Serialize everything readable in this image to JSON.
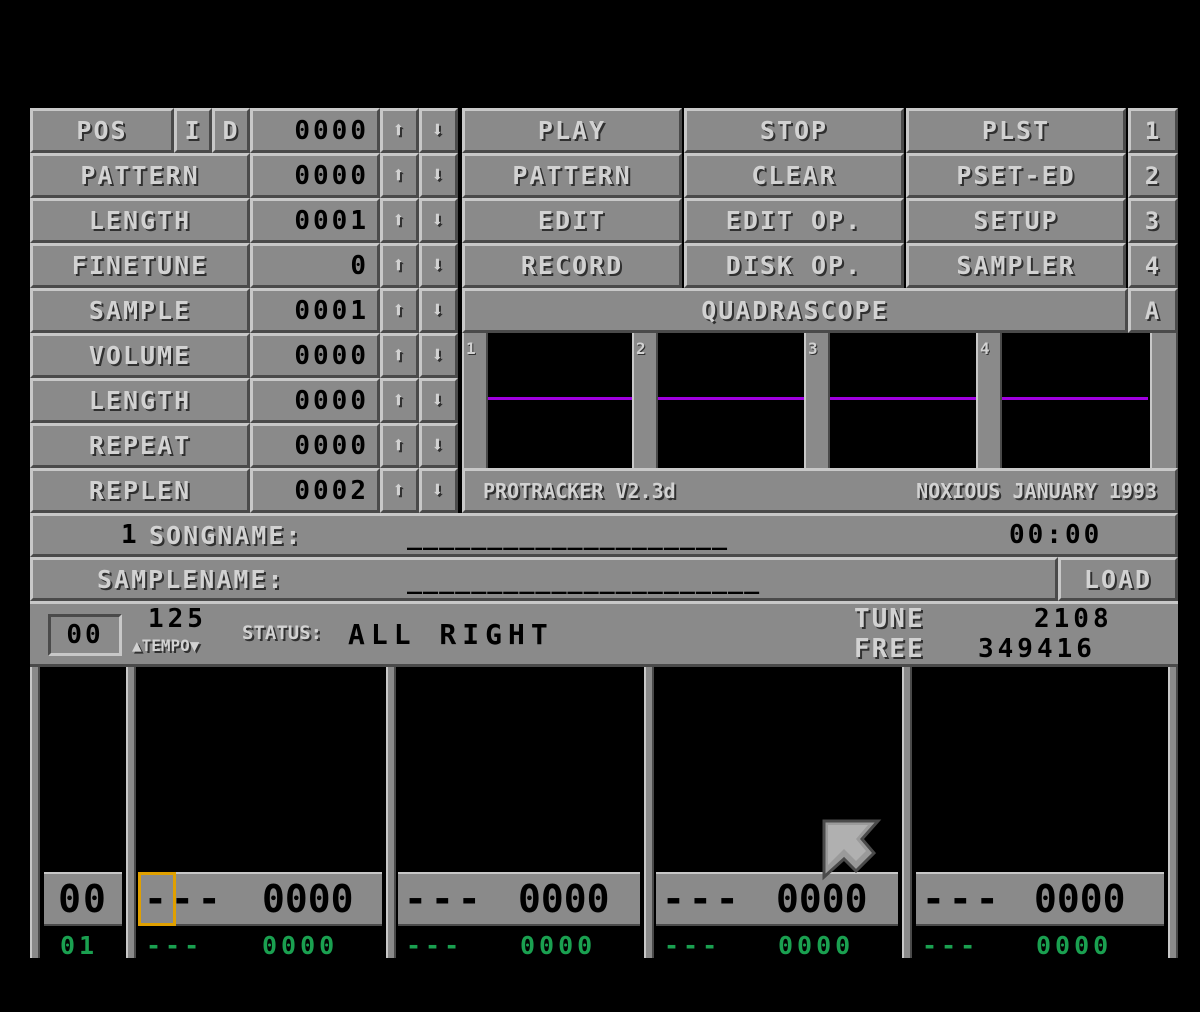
{
  "controls": {
    "pos_label": "POS",
    "i_label": "I",
    "d_label": "D",
    "pos_value": "0000",
    "pattern_label": "PATTERN",
    "pattern_value": "0000",
    "length_label": "LENGTH",
    "length_value": "0001",
    "finetune_label": "FINETUNE",
    "finetune_value": "0",
    "sample_label": "SAMPLE",
    "sample_value": "0001",
    "volume_label": "VOLUME",
    "volume_value": "0000",
    "sample_length_label": "LENGTH",
    "sample_length_value": "0000",
    "repeat_label": "REPEAT",
    "repeat_value": "0000",
    "replen_label": "REPLEN",
    "replen_value": "0002",
    "up_arrow": "⬆",
    "down_arrow": "⬇"
  },
  "menu": {
    "play": "PLAY",
    "stop": "STOP",
    "plst": "PLST",
    "pattern": "PATTERN",
    "clear": "CLEAR",
    "pset_ed": "PSET-ED",
    "edit": "EDIT",
    "edit_op": "EDIT OP.",
    "setup": "SETUP",
    "record": "RECORD",
    "disk_op": "DISK OP.",
    "sampler": "SAMPLER",
    "num1": "1",
    "num2": "2",
    "num3": "3",
    "num4": "4",
    "quadrascope": "QUADRASCOPE",
    "a": "A"
  },
  "scope": {
    "ch1": "1",
    "ch2": "2",
    "ch3": "3",
    "ch4": "4",
    "version": "PROTRACKER V2.3d",
    "credit": "NOXIOUS JANUARY 1993",
    "line_color": "#a000e0"
  },
  "song": {
    "number": "1",
    "songname_label": "SONGNAME:",
    "songname_value": "____________________",
    "time": "00:00",
    "samplename_label": "SAMPLENAME:",
    "samplename_value": "______________________",
    "load": "LOAD"
  },
  "status": {
    "box": "00",
    "tempo_value": "125",
    "tempo_label": "▲TEMPO▼",
    "status_label": "STATUS:",
    "status_text": "ALL RIGHT",
    "tune_label": "TUNE",
    "tune_value": "2108",
    "free_label": "FREE",
    "free_value": "349416"
  },
  "pattern_editor": {
    "row_number": "00",
    "next_row": "01",
    "channels": [
      {
        "note": "---",
        "effect": "0000",
        "next_note": "---",
        "next_effect": "0000"
      },
      {
        "note": "---",
        "effect": "0000",
        "next_note": "---",
        "next_effect": "0000"
      },
      {
        "note": "---",
        "effect": "0000",
        "next_note": "---",
        "next_effect": "0000"
      },
      {
        "note": "---",
        "effect": "0000",
        "next_note": "---",
        "next_effect": "0000"
      }
    ]
  }
}
